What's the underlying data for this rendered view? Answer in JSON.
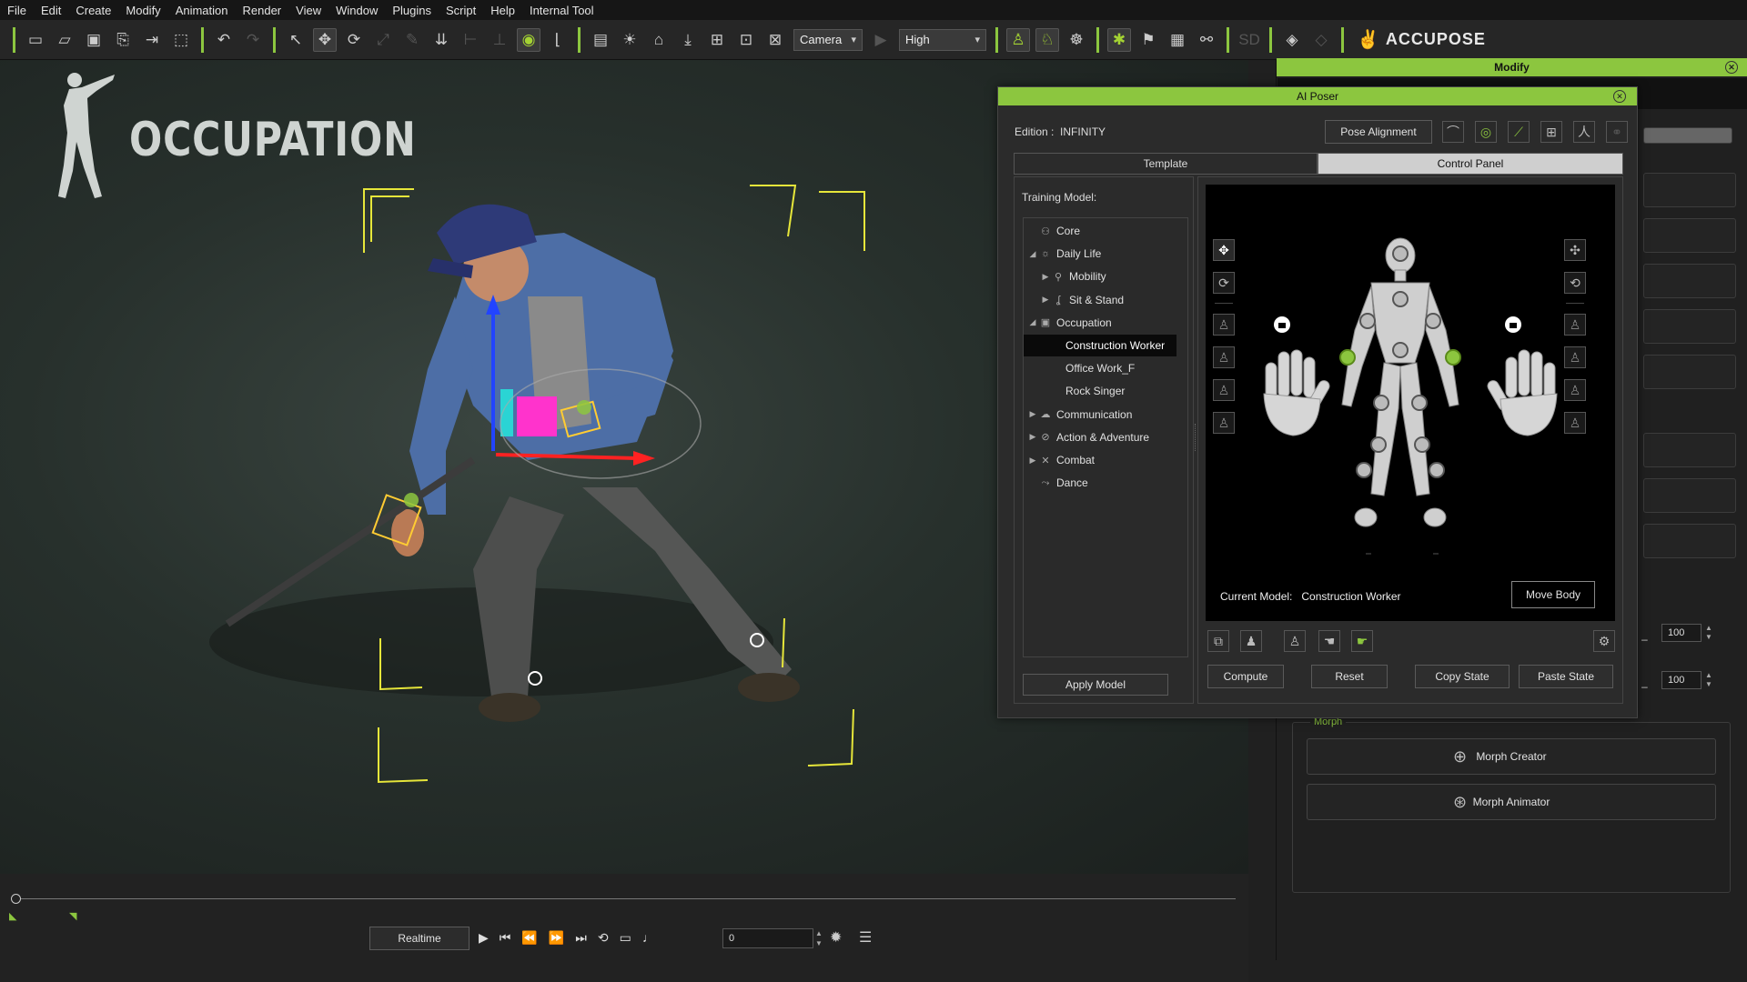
{
  "menu": [
    "File",
    "Edit",
    "Create",
    "Modify",
    "Animation",
    "Render",
    "View",
    "Window",
    "Plugins",
    "Script",
    "Help",
    "Internal Tool"
  ],
  "toolbar": {
    "view_select": "Camera",
    "quality_select": "High",
    "brand": "ACCUPOSE"
  },
  "viewport": {
    "title": "OCCUPATION"
  },
  "modify_panel": {
    "title": "Modify",
    "morph_group_label": "Morph",
    "morph_creator": "Morph Creator",
    "morph_animator": "Morph Animator",
    "field1_value": "100",
    "field2_value": "100"
  },
  "ai_poser": {
    "title": "AI Poser",
    "edition_label": "Edition :",
    "edition_value": "INFINITY",
    "pose_alignment": "Pose Alignment",
    "tabs": [
      "Template",
      "Control Panel"
    ],
    "training_model_label": "Training Model:",
    "tree": [
      {
        "label": "Core",
        "level": 0,
        "twisty": "",
        "icon": "⚇"
      },
      {
        "label": "Daily Life",
        "level": 0,
        "twisty": "◢",
        "icon": "☼"
      },
      {
        "label": "Mobility",
        "level": 1,
        "twisty": "▶",
        "icon": "⚲"
      },
      {
        "label": "Sit & Stand",
        "level": 1,
        "twisty": "▶",
        "icon": "ʆ"
      },
      {
        "label": "Occupation",
        "level": 0,
        "twisty": "◢",
        "icon": "▣"
      },
      {
        "label": "Construction Worker",
        "level": 2,
        "twisty": "",
        "icon": "",
        "selected": true
      },
      {
        "label": "Office Work_F",
        "level": 2,
        "twisty": "",
        "icon": ""
      },
      {
        "label": "Rock Singer",
        "level": 2,
        "twisty": "",
        "icon": ""
      },
      {
        "label": "Communication",
        "level": 0,
        "twisty": "▶",
        "icon": "☁"
      },
      {
        "label": "Action & Adventure",
        "level": 0,
        "twisty": "▶",
        "icon": "⊘"
      },
      {
        "label": "Combat",
        "level": 0,
        "twisty": "▶",
        "icon": "✕"
      },
      {
        "label": "Dance",
        "level": 0,
        "twisty": "",
        "icon": "⤳"
      }
    ],
    "apply_model": "Apply Model",
    "current_model_label": "Current Model:",
    "current_model_value": "Construction Worker",
    "move_body": "Move Body",
    "compute": "Compute",
    "reset": "Reset",
    "copy_state": "Copy State",
    "paste_state": "Paste State"
  },
  "timeline": {
    "realtime": "Realtime",
    "frame": "0"
  },
  "colors": {
    "accent": "#8cc63f",
    "selected_row": "#0a0a0a",
    "figure_bg": "#000000",
    "pin_active": "#8cc63f"
  }
}
